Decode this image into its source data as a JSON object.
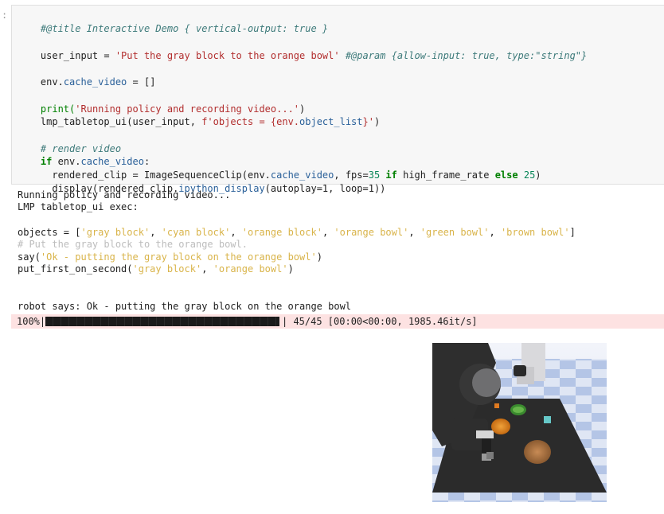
{
  "cell": {
    "prompt": ":",
    "lines": {
      "title": "#@title Interactive Demo { vertical-output: true }",
      "input_lhs": "user_input = ",
      "input_str": "'Put the gray block to the orange bowl'",
      "input_param": " #@param {allow-input: true, type:\"string\"}",
      "cache_a": "env.",
      "cache_b": "cache_video",
      "cache_c": " = []",
      "print_a": "print(",
      "print_str": "'Running policy and recording video...'",
      "print_c": ")",
      "lmp_a": "lmp_tabletop_ui(user_input, ",
      "lmp_str": "f'objects = {env.",
      "lmp_attr": "object_list",
      "lmp_str2": "}'",
      "lmp_c": ")",
      "comment_render": "# render video",
      "if_kw": "if",
      "if_a": " env.",
      "if_b": "cache_video",
      "if_c": ":",
      "clip_a": "  rendered_clip = ImageSequenceClip(env.",
      "clip_b": "cache_video",
      "clip_c": ", fps=",
      "clip_num1": "35",
      "clip_if": " if",
      "clip_d": " high_frame_rate ",
      "clip_else": "else",
      "clip_sp": " ",
      "clip_num2": "25",
      "clip_e": ")",
      "display_a": "  display(rendered_clip.",
      "display_b": "ipython_display",
      "display_c": "(autoplay=1, loop=1))"
    }
  },
  "output": {
    "running": "Running policy and recording video...",
    "exec": "LMP tabletop_ui exec:",
    "objects_a": "objects = [",
    "objects_items": [
      "'gray block'",
      "'cyan block'",
      "'orange block'",
      "'orange bowl'",
      "'green bowl'",
      "'brown bowl'"
    ],
    "objects_sep": ", ",
    "objects_c": "]",
    "comment": "# Put the gray block to the orange bowl.",
    "say_a": "say(",
    "say_str": "'Ok - putting the gray block on the orange bowl'",
    "say_c": ")",
    "put_a": "put_first_on_second(",
    "put_s1": "'gray block'",
    "put_sep": ", ",
    "put_s2": "'orange bowl'",
    "put_c": ")",
    "robot_says": "robot says: Ok - putting the gray block on the orange bowl"
  },
  "progress": {
    "percent_label": "100%|",
    "fraction": 1.0,
    "stats": "| 45/45 [00:00<00:00, 1985.46it/s]"
  },
  "colors": {
    "cell_bg": "#f7f7f7",
    "progress_bg": "#fde2e2",
    "string": "#b22e2e",
    "keyword": "#008000"
  }
}
